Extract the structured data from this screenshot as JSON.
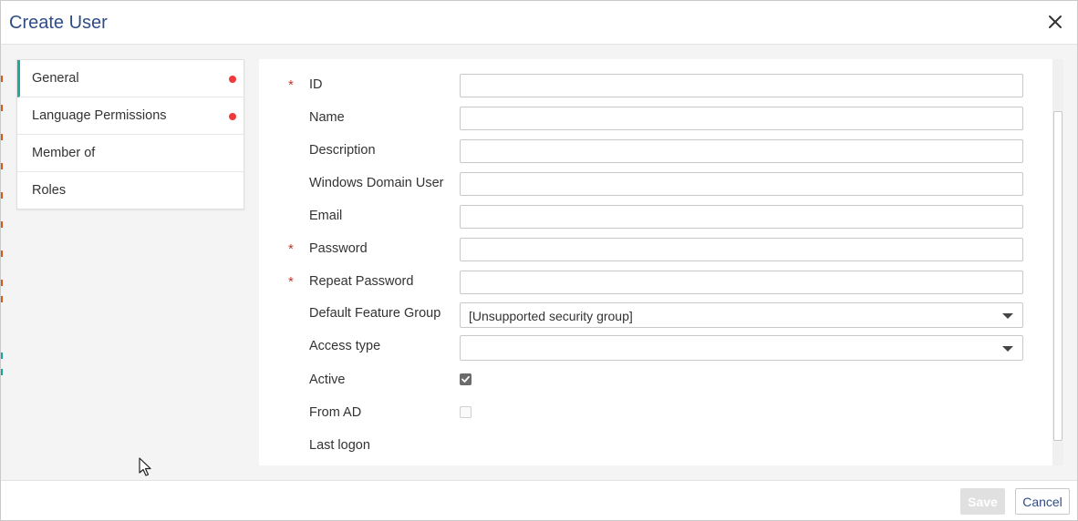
{
  "dialog": {
    "title": "Create User",
    "close_icon": "close-icon"
  },
  "nav": {
    "items": [
      {
        "label": "General",
        "active": true,
        "has_error": true
      },
      {
        "label": "Language Permissions",
        "active": false,
        "has_error": true
      },
      {
        "label": "Member of",
        "active": false,
        "has_error": false
      },
      {
        "label": "Roles",
        "active": false,
        "has_error": false
      }
    ]
  },
  "form": {
    "required_marker": "*",
    "fields": {
      "id": {
        "label": "ID",
        "value": ""
      },
      "name": {
        "label": "Name",
        "value": ""
      },
      "description": {
        "label": "Description",
        "value": ""
      },
      "windows_domain_user": {
        "label": "Windows Domain User",
        "value": ""
      },
      "email": {
        "label": "Email",
        "value": ""
      },
      "password": {
        "label": "Password",
        "value": ""
      },
      "repeat_password": {
        "label": "Repeat Password",
        "value": ""
      },
      "default_feature_group": {
        "label": "Default Feature Group",
        "value": "[Unsupported security group]"
      },
      "access_type": {
        "label": "Access type",
        "value": ""
      },
      "active": {
        "label": "Active",
        "checked": true
      },
      "from_ad": {
        "label": "From AD",
        "checked": false
      },
      "last_logon": {
        "label": "Last logon"
      }
    }
  },
  "footer": {
    "save_label": "Save",
    "cancel_label": "Cancel"
  },
  "colors": {
    "title": "#2e4d87",
    "accent": "#21a89a",
    "error_dot": "#ee3a3a",
    "required": "#c0392b"
  }
}
